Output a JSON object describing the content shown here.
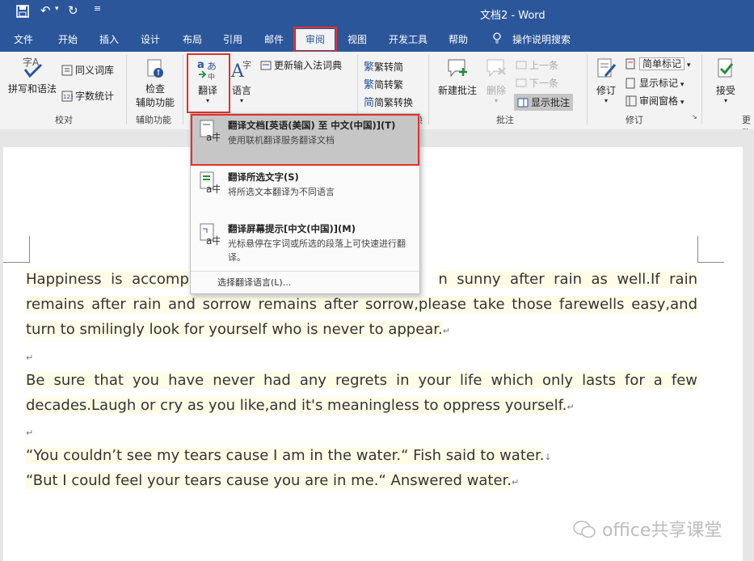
{
  "titlebar": {
    "doc_title": "文档2 - Word",
    "qat": [
      "save-icon",
      "undo-icon",
      "redo-icon",
      "customize-icon"
    ]
  },
  "tabs": [
    "文件",
    "开始",
    "插入",
    "设计",
    "布局",
    "引用",
    "邮件",
    "审阅",
    "视图",
    "开发工具",
    "帮助",
    "操作说明搜索"
  ],
  "active_tab": "审阅",
  "ribbon": {
    "proofing": {
      "spelling": "拼写和语法",
      "thesaurus": "同义词库",
      "wordcount": "字数统计",
      "group": "校对"
    },
    "accessibility": {
      "check": "检查",
      "check2": "辅助功能",
      "group": "辅助功能"
    },
    "translate": "翻译",
    "language": "语言",
    "ime_dict": "更新输入法词典",
    "chinese": {
      "t2s": "繁转简",
      "s2t": "简转繁",
      "convert": "简繁转换",
      "group_suffix": "换"
    },
    "comments": {
      "new": "新建批注",
      "delete": "删除",
      "prev": "上一条",
      "next": "下一条",
      "show": "显示批注",
      "group": "批注"
    },
    "tracking": {
      "track": "修订",
      "simple": "简单标记",
      "show_markup": "显示标记",
      "pane": "审阅窗格",
      "group": "修订"
    },
    "changes": {
      "accept": "接受",
      "group_partial": "更改"
    }
  },
  "menu": {
    "items": [
      {
        "title": "翻译文档[英语(美国) 至 中文(中国)](T)",
        "desc": "使用联机翻译服务翻译文档"
      },
      {
        "title": "翻译所选文字(S)",
        "desc": "将所选文本翻译为不同语言"
      },
      {
        "title": "翻译屏幕提示[中文(中国)](M)",
        "desc": "光标悬停在字词或所选的段落上可快速进行翻译。"
      }
    ],
    "footer": "选择翻译语言(L)..."
  },
  "document": {
    "p1_visible": "Happiness is accompar",
    "p1_rest": "n sunny after rain as well.If rain remains after rain and sorrow remains after sorrow,please take those farewells easy,and turn to smilingly look for yourself who is never to appear.",
    "p2": "Be sure that you have never had any regrets in your life which only lasts for a few decades.Laugh or cry as you like,and it's meaningless to oppress yourself.",
    "p3": "“You couldn’t see my tears cause I am in the water.“  Fish said to water.",
    "p4": "“But I could feel your tears cause you are in me.“  Answered water."
  },
  "watermark": "office共享课堂",
  "colors": {
    "accent": "#2b579a",
    "highlight_box": "#e0312c"
  }
}
